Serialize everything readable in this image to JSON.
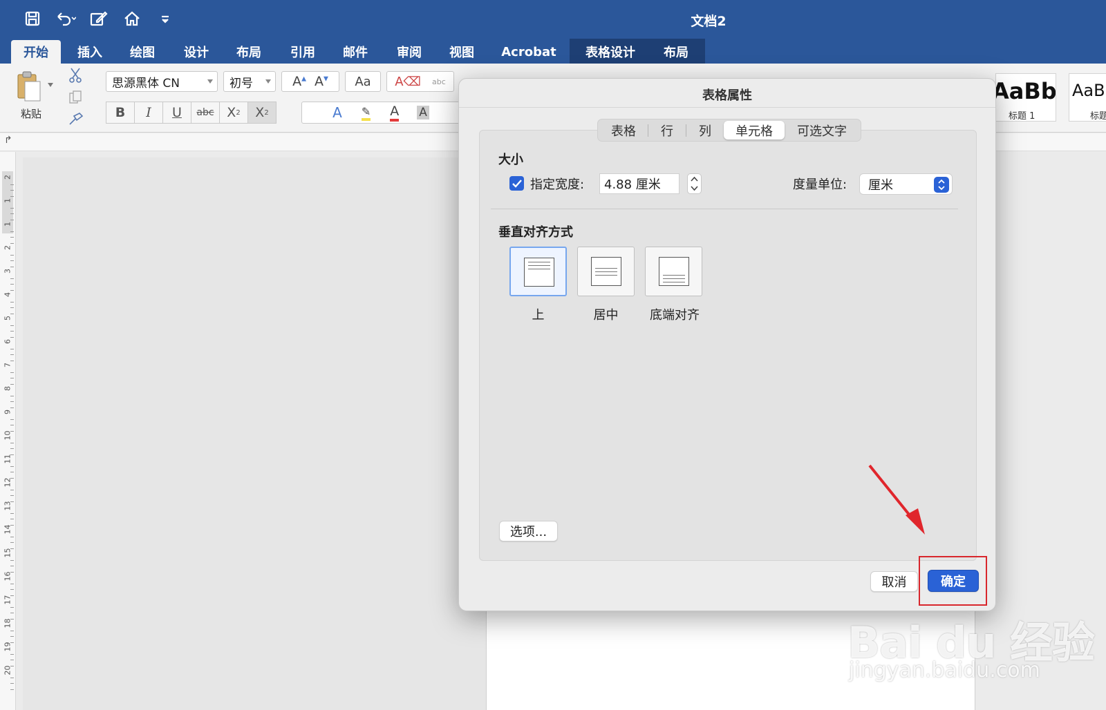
{
  "window": {
    "title": "文档2"
  },
  "tabs": [
    {
      "label": "开始"
    },
    {
      "label": "插入"
    },
    {
      "label": "绘图"
    },
    {
      "label": "设计"
    },
    {
      "label": "布局"
    },
    {
      "label": "引用"
    },
    {
      "label": "邮件"
    },
    {
      "label": "审阅"
    },
    {
      "label": "视图"
    },
    {
      "label": "Acrobat"
    },
    {
      "label": "表格设计"
    },
    {
      "label": "布局"
    }
  ],
  "ribbon": {
    "paste_label": "粘贴",
    "font_name": "思源黑体 CN",
    "font_size": "初号",
    "styles": [
      {
        "preview": "AaBbC",
        "caption": "标题 1"
      },
      {
        "preview": "AaBb",
        "caption": "标题"
      }
    ]
  },
  "ruler": {
    "numbers": [
      "2",
      "1",
      "1",
      "2",
      "3",
      "4",
      "5",
      "6",
      "7",
      "8",
      "9",
      "10",
      "11",
      "12",
      "13",
      "14",
      "15",
      "16",
      "17",
      "18",
      "19",
      "20"
    ]
  },
  "dialog": {
    "title": "表格属性",
    "tabs": [
      {
        "label": "表格"
      },
      {
        "label": "行"
      },
      {
        "label": "列"
      },
      {
        "label": "单元格",
        "active": true
      },
      {
        "label": "可选文字"
      }
    ],
    "size_section": "大小",
    "width_checkbox_label": "指定宽度:",
    "width_checked": true,
    "width_value": "4.88 厘米",
    "unit_label": "度量单位:",
    "unit_value": "厘米",
    "valign_section": "垂直对齐方式",
    "valign_options": [
      {
        "label": "上",
        "selected": true
      },
      {
        "label": "居中",
        "selected": false
      },
      {
        "label": "底端对齐",
        "selected": false
      }
    ],
    "options_button": "选项...",
    "cancel_button": "取消",
    "ok_button": "确定"
  },
  "watermark": {
    "brand": "Bai du 经验",
    "url": "jingyan.baidu.com"
  },
  "colors": {
    "ribbon_blue": "#2b579a",
    "accent": "#2a62d6",
    "highlight_red": "#d8262c"
  }
}
